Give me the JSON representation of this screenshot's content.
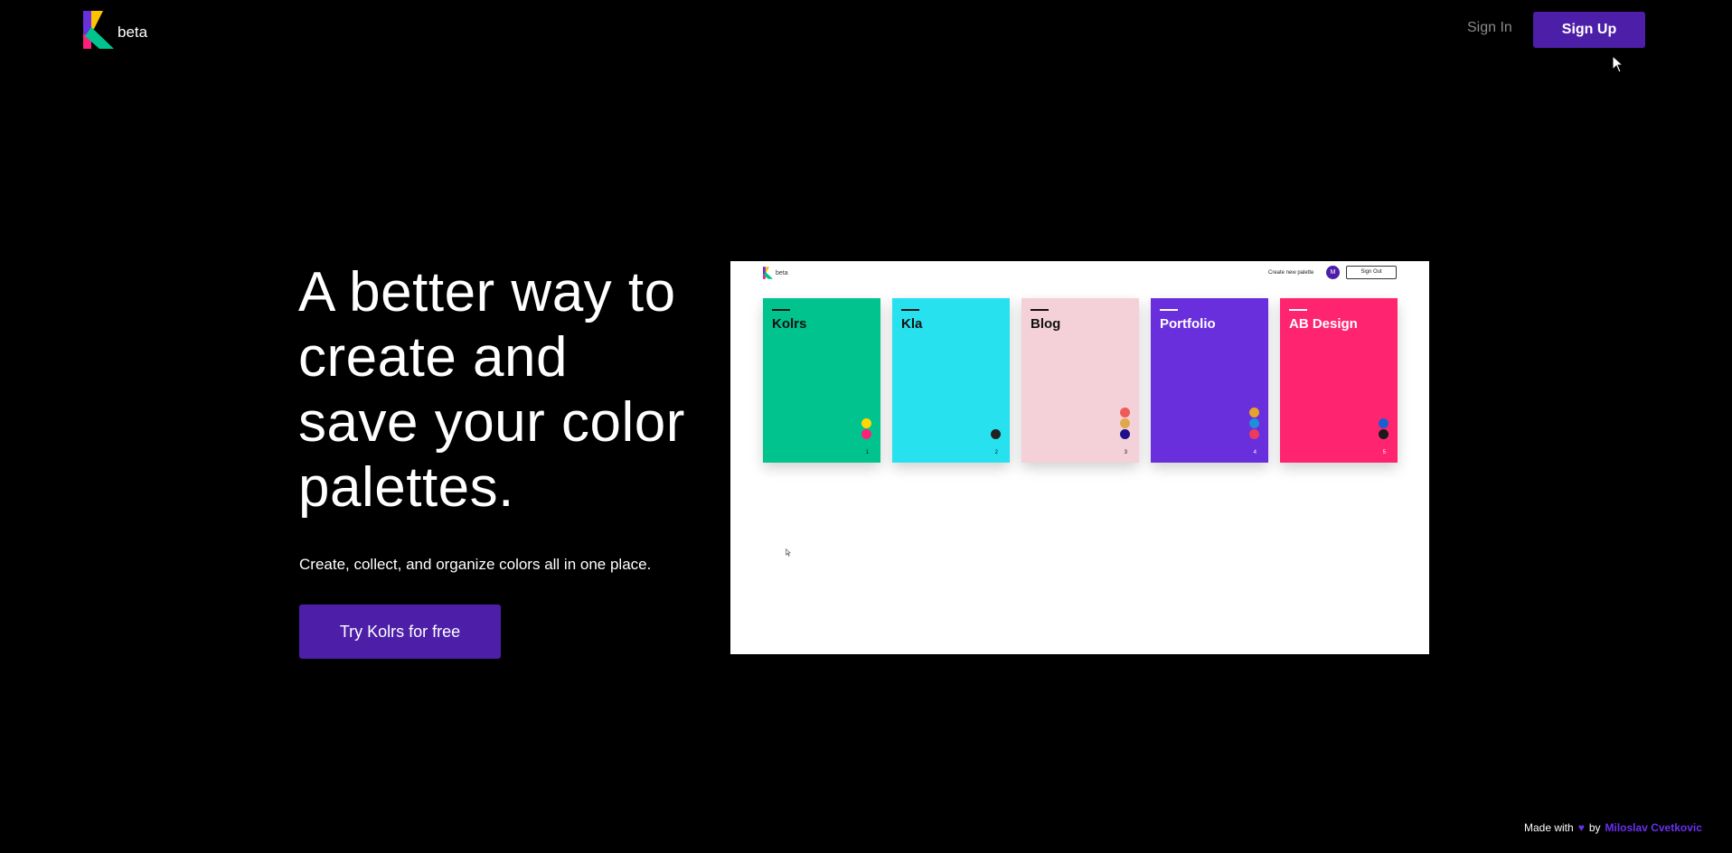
{
  "header": {
    "logo_text": "beta",
    "signin_label": "Sign In",
    "signup_label": "Sign Up"
  },
  "hero": {
    "title": "A better way to create and save your color palettes.",
    "subtitle": "Create, collect, and organize colors all in one place.",
    "cta_label": "Try Kolrs for free"
  },
  "preview": {
    "logo_text": "beta",
    "create_label": "Create new palette",
    "avatar_initial": "M",
    "signout_label": "Sign Out",
    "palettes": [
      {
        "name": "Kolrs",
        "number": "1",
        "bg": "#00c38e",
        "text_color": "#111111",
        "colors": [
          "#ffd800",
          "#ff1f7a"
        ]
      },
      {
        "name": "Kla",
        "number": "2",
        "bg": "#27e2ee",
        "text_color": "#111111",
        "colors": [
          "#222222"
        ]
      },
      {
        "name": "Blog",
        "number": "3",
        "bg": "#f4d1d8",
        "text_color": "#111111",
        "colors": [
          "#ef5a5a",
          "#e0a84a",
          "#1f0f8a"
        ]
      },
      {
        "name": "Portfolio",
        "number": "4",
        "bg": "#6a2fdc",
        "text_color": "#ffffff",
        "colors": [
          "#e7a22a",
          "#1f8fd8",
          "#ee3a5e"
        ]
      },
      {
        "name": "AB Design",
        "number": "5",
        "bg": "#ff2470",
        "text_color": "#ffffff",
        "colors": [
          "#1a5fd0",
          "#1a1a1a"
        ]
      }
    ]
  },
  "footer": {
    "made_with": "Made with",
    "heart": "♥",
    "by": "by",
    "author": "Miloslav Cvetkovic"
  },
  "colors": {
    "accent": "#4d1fa8",
    "background": "#000000",
    "footer_link": "#6a2ff0"
  }
}
